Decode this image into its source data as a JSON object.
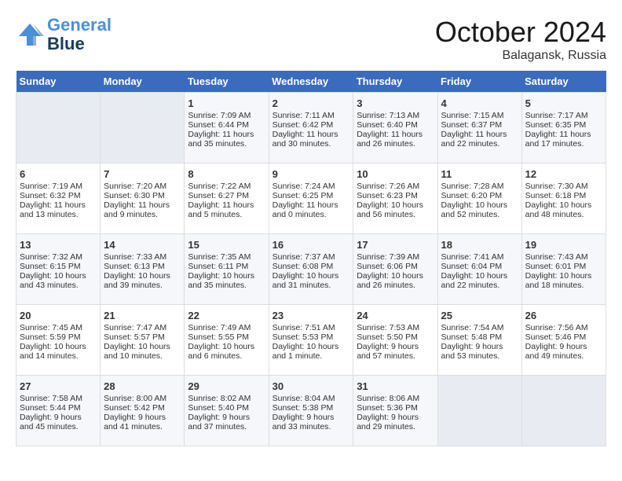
{
  "header": {
    "logo_line1": "General",
    "logo_line2": "Blue",
    "month": "October 2024",
    "location": "Balagansk, Russia"
  },
  "days_of_week": [
    "Sunday",
    "Monday",
    "Tuesday",
    "Wednesday",
    "Thursday",
    "Friday",
    "Saturday"
  ],
  "weeks": [
    [
      {
        "day": "",
        "sunrise": "",
        "sunset": "",
        "daylight": "",
        "empty": true
      },
      {
        "day": "",
        "sunrise": "",
        "sunset": "",
        "daylight": "",
        "empty": true
      },
      {
        "day": "1",
        "sunrise": "Sunrise: 7:09 AM",
        "sunset": "Sunset: 6:44 PM",
        "daylight": "Daylight: 11 hours and 35 minutes."
      },
      {
        "day": "2",
        "sunrise": "Sunrise: 7:11 AM",
        "sunset": "Sunset: 6:42 PM",
        "daylight": "Daylight: 11 hours and 30 minutes."
      },
      {
        "day": "3",
        "sunrise": "Sunrise: 7:13 AM",
        "sunset": "Sunset: 6:40 PM",
        "daylight": "Daylight: 11 hours and 26 minutes."
      },
      {
        "day": "4",
        "sunrise": "Sunrise: 7:15 AM",
        "sunset": "Sunset: 6:37 PM",
        "daylight": "Daylight: 11 hours and 22 minutes."
      },
      {
        "day": "5",
        "sunrise": "Sunrise: 7:17 AM",
        "sunset": "Sunset: 6:35 PM",
        "daylight": "Daylight: 11 hours and 17 minutes."
      }
    ],
    [
      {
        "day": "6",
        "sunrise": "Sunrise: 7:19 AM",
        "sunset": "Sunset: 6:32 PM",
        "daylight": "Daylight: 11 hours and 13 minutes."
      },
      {
        "day": "7",
        "sunrise": "Sunrise: 7:20 AM",
        "sunset": "Sunset: 6:30 PM",
        "daylight": "Daylight: 11 hours and 9 minutes."
      },
      {
        "day": "8",
        "sunrise": "Sunrise: 7:22 AM",
        "sunset": "Sunset: 6:27 PM",
        "daylight": "Daylight: 11 hours and 5 minutes."
      },
      {
        "day": "9",
        "sunrise": "Sunrise: 7:24 AM",
        "sunset": "Sunset: 6:25 PM",
        "daylight": "Daylight: 11 hours and 0 minutes."
      },
      {
        "day": "10",
        "sunrise": "Sunrise: 7:26 AM",
        "sunset": "Sunset: 6:23 PM",
        "daylight": "Daylight: 10 hours and 56 minutes."
      },
      {
        "day": "11",
        "sunrise": "Sunrise: 7:28 AM",
        "sunset": "Sunset: 6:20 PM",
        "daylight": "Daylight: 10 hours and 52 minutes."
      },
      {
        "day": "12",
        "sunrise": "Sunrise: 7:30 AM",
        "sunset": "Sunset: 6:18 PM",
        "daylight": "Daylight: 10 hours and 48 minutes."
      }
    ],
    [
      {
        "day": "13",
        "sunrise": "Sunrise: 7:32 AM",
        "sunset": "Sunset: 6:15 PM",
        "daylight": "Daylight: 10 hours and 43 minutes."
      },
      {
        "day": "14",
        "sunrise": "Sunrise: 7:33 AM",
        "sunset": "Sunset: 6:13 PM",
        "daylight": "Daylight: 10 hours and 39 minutes."
      },
      {
        "day": "15",
        "sunrise": "Sunrise: 7:35 AM",
        "sunset": "Sunset: 6:11 PM",
        "daylight": "Daylight: 10 hours and 35 minutes."
      },
      {
        "day": "16",
        "sunrise": "Sunrise: 7:37 AM",
        "sunset": "Sunset: 6:08 PM",
        "daylight": "Daylight: 10 hours and 31 minutes."
      },
      {
        "day": "17",
        "sunrise": "Sunrise: 7:39 AM",
        "sunset": "Sunset: 6:06 PM",
        "daylight": "Daylight: 10 hours and 26 minutes."
      },
      {
        "day": "18",
        "sunrise": "Sunrise: 7:41 AM",
        "sunset": "Sunset: 6:04 PM",
        "daylight": "Daylight: 10 hours and 22 minutes."
      },
      {
        "day": "19",
        "sunrise": "Sunrise: 7:43 AM",
        "sunset": "Sunset: 6:01 PM",
        "daylight": "Daylight: 10 hours and 18 minutes."
      }
    ],
    [
      {
        "day": "20",
        "sunrise": "Sunrise: 7:45 AM",
        "sunset": "Sunset: 5:59 PM",
        "daylight": "Daylight: 10 hours and 14 minutes."
      },
      {
        "day": "21",
        "sunrise": "Sunrise: 7:47 AM",
        "sunset": "Sunset: 5:57 PM",
        "daylight": "Daylight: 10 hours and 10 minutes."
      },
      {
        "day": "22",
        "sunrise": "Sunrise: 7:49 AM",
        "sunset": "Sunset: 5:55 PM",
        "daylight": "Daylight: 10 hours and 6 minutes."
      },
      {
        "day": "23",
        "sunrise": "Sunrise: 7:51 AM",
        "sunset": "Sunset: 5:53 PM",
        "daylight": "Daylight: 10 hours and 1 minute."
      },
      {
        "day": "24",
        "sunrise": "Sunrise: 7:53 AM",
        "sunset": "Sunset: 5:50 PM",
        "daylight": "Daylight: 9 hours and 57 minutes."
      },
      {
        "day": "25",
        "sunrise": "Sunrise: 7:54 AM",
        "sunset": "Sunset: 5:48 PM",
        "daylight": "Daylight: 9 hours and 53 minutes."
      },
      {
        "day": "26",
        "sunrise": "Sunrise: 7:56 AM",
        "sunset": "Sunset: 5:46 PM",
        "daylight": "Daylight: 9 hours and 49 minutes."
      }
    ],
    [
      {
        "day": "27",
        "sunrise": "Sunrise: 7:58 AM",
        "sunset": "Sunset: 5:44 PM",
        "daylight": "Daylight: 9 hours and 45 minutes."
      },
      {
        "day": "28",
        "sunrise": "Sunrise: 8:00 AM",
        "sunset": "Sunset: 5:42 PM",
        "daylight": "Daylight: 9 hours and 41 minutes."
      },
      {
        "day": "29",
        "sunrise": "Sunrise: 8:02 AM",
        "sunset": "Sunset: 5:40 PM",
        "daylight": "Daylight: 9 hours and 37 minutes."
      },
      {
        "day": "30",
        "sunrise": "Sunrise: 8:04 AM",
        "sunset": "Sunset: 5:38 PM",
        "daylight": "Daylight: 9 hours and 33 minutes."
      },
      {
        "day": "31",
        "sunrise": "Sunrise: 8:06 AM",
        "sunset": "Sunset: 5:36 PM",
        "daylight": "Daylight: 9 hours and 29 minutes."
      },
      {
        "day": "",
        "sunrise": "",
        "sunset": "",
        "daylight": "",
        "empty": true
      },
      {
        "day": "",
        "sunrise": "",
        "sunset": "",
        "daylight": "",
        "empty": true
      }
    ]
  ]
}
